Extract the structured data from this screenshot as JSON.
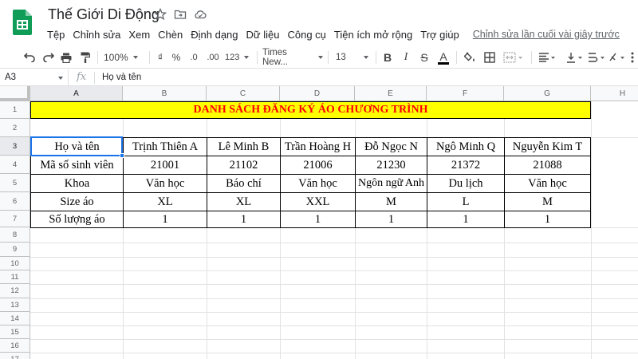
{
  "app": {
    "doc_title": "Thế Giới Di Động",
    "menu": [
      "Tệp",
      "Chỉnh sửa",
      "Xem",
      "Chèn",
      "Định dạng",
      "Dữ liệu",
      "Công cụ",
      "Tiện ích mở rộng",
      "Trợ giúp"
    ],
    "last_edit": "Chỉnh sửa lần cuối vài giây trước"
  },
  "toolbar": {
    "zoom": "100%",
    "currency": "₫",
    "percent": "%",
    "dec_decrease": ".0",
    "dec_increase": ".00",
    "number_format": "123",
    "font": "Times New...",
    "font_size": "13",
    "bold": "B",
    "italic": "I",
    "strike": "S",
    "text_color": "A"
  },
  "formula_bar": {
    "cell_ref": "A3",
    "fx": "fx",
    "content": "Họ và tên"
  },
  "columns": [
    "A",
    "B",
    "C",
    "D",
    "E",
    "F",
    "G",
    "H"
  ],
  "rows": [
    "1",
    "2",
    "3",
    "4",
    "5",
    "6",
    "7",
    "8",
    "9",
    "10",
    "11",
    "12",
    "13",
    "14",
    "15",
    "16",
    "17"
  ],
  "sheet": {
    "banner": "DANH SÁCH ĐĂNG KÝ ÁO CHƯƠNG TRÌNH",
    "table": [
      [
        "Họ và tên",
        "Trịnh Thiên A",
        "Lê Minh B",
        "Trần Hoàng H",
        "Đỗ Ngọc N",
        "Ngô Minh Q",
        "Nguyễn Kim T"
      ],
      [
        "Mã số sinh viên",
        "21001",
        "21102",
        "21006",
        "21230",
        "21372",
        "21088"
      ],
      [
        "Khoa",
        "Văn học",
        "Báo chí",
        "Văn học",
        "Ngôn ngữ Anh",
        "Du lịch",
        "Văn học"
      ],
      [
        "Size áo",
        "XL",
        "XL",
        "XXL",
        "M",
        "L",
        "M"
      ],
      [
        "Số lượng áo",
        "1",
        "1",
        "1",
        "1",
        "1",
        "1"
      ]
    ]
  },
  "colors": {
    "banner_bg": "#ffff00",
    "banner_text": "#ff0000",
    "selection": "#1a73e8",
    "sheets_green": "#0f9d58"
  }
}
